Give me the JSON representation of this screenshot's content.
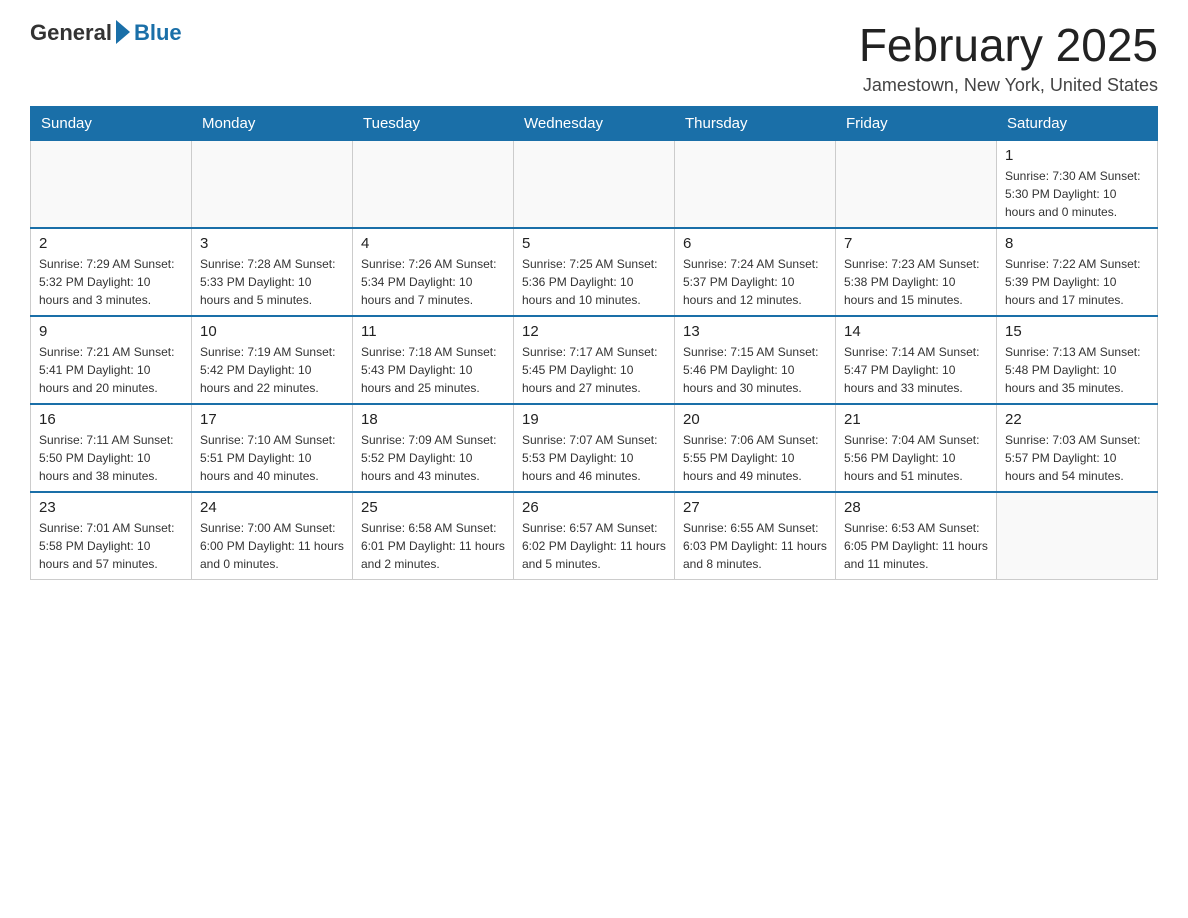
{
  "logo": {
    "general": "General",
    "blue": "Blue"
  },
  "title": {
    "month_year": "February 2025",
    "location": "Jamestown, New York, United States"
  },
  "days_of_week": [
    "Sunday",
    "Monday",
    "Tuesday",
    "Wednesday",
    "Thursday",
    "Friday",
    "Saturday"
  ],
  "weeks": [
    [
      {
        "day": "",
        "info": ""
      },
      {
        "day": "",
        "info": ""
      },
      {
        "day": "",
        "info": ""
      },
      {
        "day": "",
        "info": ""
      },
      {
        "day": "",
        "info": ""
      },
      {
        "day": "",
        "info": ""
      },
      {
        "day": "1",
        "info": "Sunrise: 7:30 AM\nSunset: 5:30 PM\nDaylight: 10 hours and 0 minutes."
      }
    ],
    [
      {
        "day": "2",
        "info": "Sunrise: 7:29 AM\nSunset: 5:32 PM\nDaylight: 10 hours and 3 minutes."
      },
      {
        "day": "3",
        "info": "Sunrise: 7:28 AM\nSunset: 5:33 PM\nDaylight: 10 hours and 5 minutes."
      },
      {
        "day": "4",
        "info": "Sunrise: 7:26 AM\nSunset: 5:34 PM\nDaylight: 10 hours and 7 minutes."
      },
      {
        "day": "5",
        "info": "Sunrise: 7:25 AM\nSunset: 5:36 PM\nDaylight: 10 hours and 10 minutes."
      },
      {
        "day": "6",
        "info": "Sunrise: 7:24 AM\nSunset: 5:37 PM\nDaylight: 10 hours and 12 minutes."
      },
      {
        "day": "7",
        "info": "Sunrise: 7:23 AM\nSunset: 5:38 PM\nDaylight: 10 hours and 15 minutes."
      },
      {
        "day": "8",
        "info": "Sunrise: 7:22 AM\nSunset: 5:39 PM\nDaylight: 10 hours and 17 minutes."
      }
    ],
    [
      {
        "day": "9",
        "info": "Sunrise: 7:21 AM\nSunset: 5:41 PM\nDaylight: 10 hours and 20 minutes."
      },
      {
        "day": "10",
        "info": "Sunrise: 7:19 AM\nSunset: 5:42 PM\nDaylight: 10 hours and 22 minutes."
      },
      {
        "day": "11",
        "info": "Sunrise: 7:18 AM\nSunset: 5:43 PM\nDaylight: 10 hours and 25 minutes."
      },
      {
        "day": "12",
        "info": "Sunrise: 7:17 AM\nSunset: 5:45 PM\nDaylight: 10 hours and 27 minutes."
      },
      {
        "day": "13",
        "info": "Sunrise: 7:15 AM\nSunset: 5:46 PM\nDaylight: 10 hours and 30 minutes."
      },
      {
        "day": "14",
        "info": "Sunrise: 7:14 AM\nSunset: 5:47 PM\nDaylight: 10 hours and 33 minutes."
      },
      {
        "day": "15",
        "info": "Sunrise: 7:13 AM\nSunset: 5:48 PM\nDaylight: 10 hours and 35 minutes."
      }
    ],
    [
      {
        "day": "16",
        "info": "Sunrise: 7:11 AM\nSunset: 5:50 PM\nDaylight: 10 hours and 38 minutes."
      },
      {
        "day": "17",
        "info": "Sunrise: 7:10 AM\nSunset: 5:51 PM\nDaylight: 10 hours and 40 minutes."
      },
      {
        "day": "18",
        "info": "Sunrise: 7:09 AM\nSunset: 5:52 PM\nDaylight: 10 hours and 43 minutes."
      },
      {
        "day": "19",
        "info": "Sunrise: 7:07 AM\nSunset: 5:53 PM\nDaylight: 10 hours and 46 minutes."
      },
      {
        "day": "20",
        "info": "Sunrise: 7:06 AM\nSunset: 5:55 PM\nDaylight: 10 hours and 49 minutes."
      },
      {
        "day": "21",
        "info": "Sunrise: 7:04 AM\nSunset: 5:56 PM\nDaylight: 10 hours and 51 minutes."
      },
      {
        "day": "22",
        "info": "Sunrise: 7:03 AM\nSunset: 5:57 PM\nDaylight: 10 hours and 54 minutes."
      }
    ],
    [
      {
        "day": "23",
        "info": "Sunrise: 7:01 AM\nSunset: 5:58 PM\nDaylight: 10 hours and 57 minutes."
      },
      {
        "day": "24",
        "info": "Sunrise: 7:00 AM\nSunset: 6:00 PM\nDaylight: 11 hours and 0 minutes."
      },
      {
        "day": "25",
        "info": "Sunrise: 6:58 AM\nSunset: 6:01 PM\nDaylight: 11 hours and 2 minutes."
      },
      {
        "day": "26",
        "info": "Sunrise: 6:57 AM\nSunset: 6:02 PM\nDaylight: 11 hours and 5 minutes."
      },
      {
        "day": "27",
        "info": "Sunrise: 6:55 AM\nSunset: 6:03 PM\nDaylight: 11 hours and 8 minutes."
      },
      {
        "day": "28",
        "info": "Sunrise: 6:53 AM\nSunset: 6:05 PM\nDaylight: 11 hours and 11 minutes."
      },
      {
        "day": "",
        "info": ""
      }
    ]
  ]
}
